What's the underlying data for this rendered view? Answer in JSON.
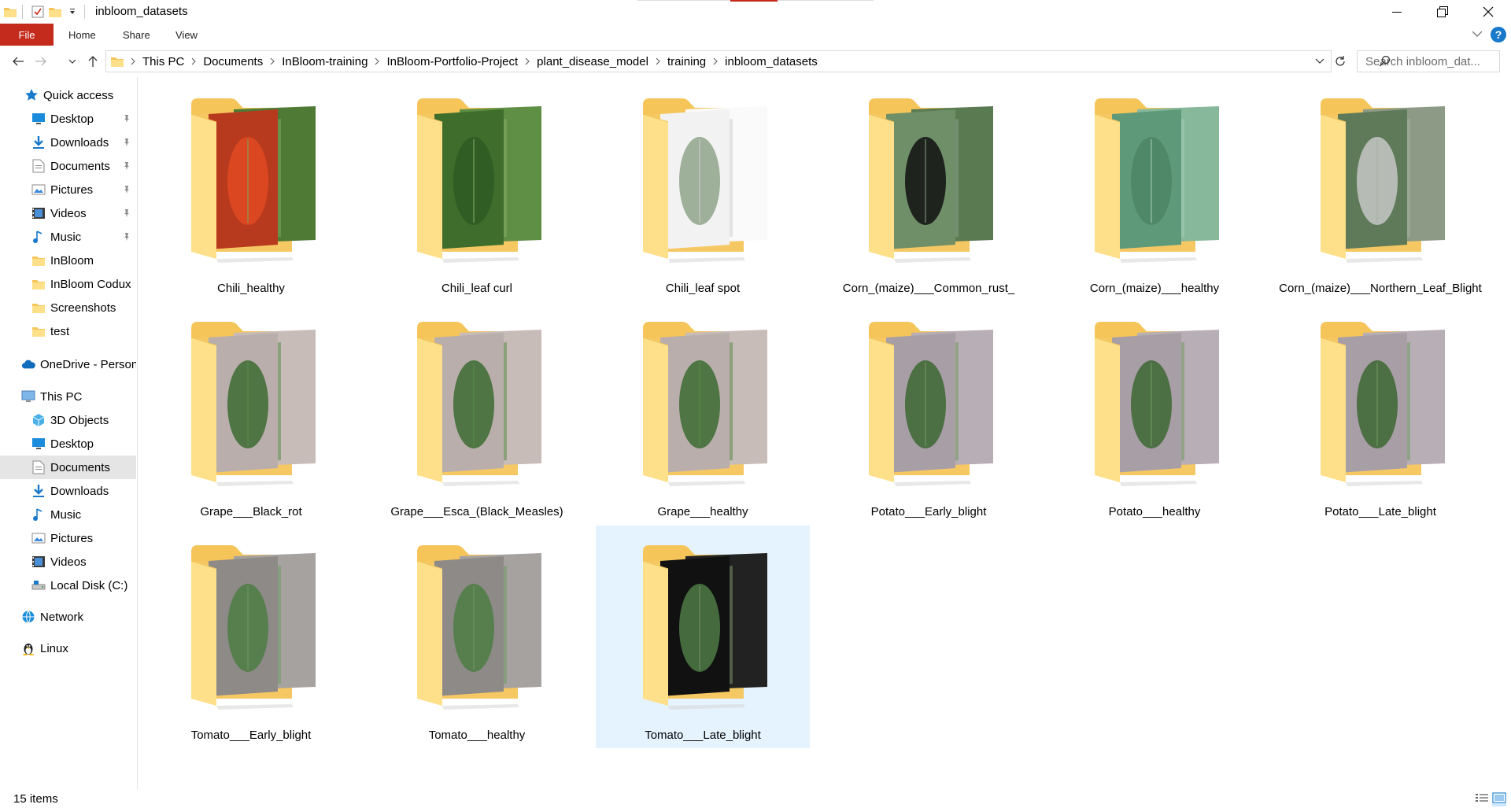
{
  "window": {
    "title": "inbloom_datasets"
  },
  "ribbon": {
    "tabs": [
      {
        "label": "File"
      },
      {
        "label": "Home"
      },
      {
        "label": "Share"
      },
      {
        "label": "View"
      }
    ]
  },
  "address": {
    "path": [
      "This PC",
      "Documents",
      "InBloom-training",
      "InBloom-Portfolio-Project",
      "plant_disease_model",
      "training",
      "inbloom_datasets"
    ]
  },
  "search": {
    "placeholder": "Search inbloom_dat..."
  },
  "sidebar": {
    "items": [
      {
        "label": "Quick access",
        "icon": "star-icon",
        "pinned": false
      },
      {
        "label": "Desktop",
        "icon": "desktop-icon",
        "pinned": true
      },
      {
        "label": "Downloads",
        "icon": "download-icon",
        "pinned": true
      },
      {
        "label": "Documents",
        "icon": "documents-icon",
        "pinned": true
      },
      {
        "label": "Pictures",
        "icon": "pictures-icon",
        "pinned": true
      },
      {
        "label": "Videos",
        "icon": "videos-icon",
        "pinned": true
      },
      {
        "label": "Music",
        "icon": "music-icon",
        "pinned": true
      },
      {
        "label": "InBloom",
        "icon": "folder-icon",
        "pinned": false
      },
      {
        "label": "InBloom Codux",
        "icon": "folder-icon",
        "pinned": false
      },
      {
        "label": "Screenshots",
        "icon": "folder-icon",
        "pinned": false
      },
      {
        "label": "test",
        "icon": "folder-icon",
        "pinned": false
      },
      {
        "label": "OneDrive - Person",
        "icon": "cloud-icon",
        "pinned": false
      },
      {
        "label": "This PC",
        "icon": "computer-icon",
        "pinned": false
      },
      {
        "label": "3D Objects",
        "icon": "cube-icon",
        "pinned": false
      },
      {
        "label": "Desktop",
        "icon": "desktop-icon",
        "pinned": false
      },
      {
        "label": "Documents",
        "icon": "documents-icon",
        "pinned": false,
        "selected": true
      },
      {
        "label": "Downloads",
        "icon": "download-icon",
        "pinned": false
      },
      {
        "label": "Music",
        "icon": "music-icon",
        "pinned": false
      },
      {
        "label": "Pictures",
        "icon": "pictures-icon",
        "pinned": false
      },
      {
        "label": "Videos",
        "icon": "videos-icon",
        "pinned": false
      },
      {
        "label": "Local Disk (C:)",
        "icon": "disk-icon",
        "pinned": false
      },
      {
        "label": "Network",
        "icon": "network-icon",
        "pinned": false
      },
      {
        "label": "Linux",
        "icon": "linux-icon",
        "pinned": false
      }
    ]
  },
  "folders": [
    {
      "name": "Chili_healthy",
      "theme": "chili"
    },
    {
      "name": "Chili_leaf curl",
      "theme": "chiligreen"
    },
    {
      "name": "Chili_leaf spot",
      "theme": "white"
    },
    {
      "name": "Corn_(maize)___Common_rust_",
      "theme": "cornrust"
    },
    {
      "name": "Corn_(maize)___healthy",
      "theme": "corn"
    },
    {
      "name": "Corn_(maize)___Northern_Leaf_Blight",
      "theme": "cornblight"
    },
    {
      "name": "Grape___Black_rot",
      "theme": "grape"
    },
    {
      "name": "Grape___Esca_(Black_Measles)",
      "theme": "grape"
    },
    {
      "name": "Grape___healthy",
      "theme": "grape"
    },
    {
      "name": "Potato___Early_blight",
      "theme": "potato"
    },
    {
      "name": "Potato___healthy",
      "theme": "potato"
    },
    {
      "name": "Potato___Late_blight",
      "theme": "potato"
    },
    {
      "name": "Tomato___Early_blight",
      "theme": "tomato"
    },
    {
      "name": "Tomato___healthy",
      "theme": "tomato"
    },
    {
      "name": "Tomato___Late_blight",
      "theme": "tomatodark",
      "selected": true
    }
  ],
  "status": {
    "item_count": "15 items"
  },
  "colors": {
    "file_tab": "#c42b1c",
    "selection": "#e5f3fe",
    "folder_front": "#ffe08a",
    "folder_back": "#f5c55a"
  }
}
